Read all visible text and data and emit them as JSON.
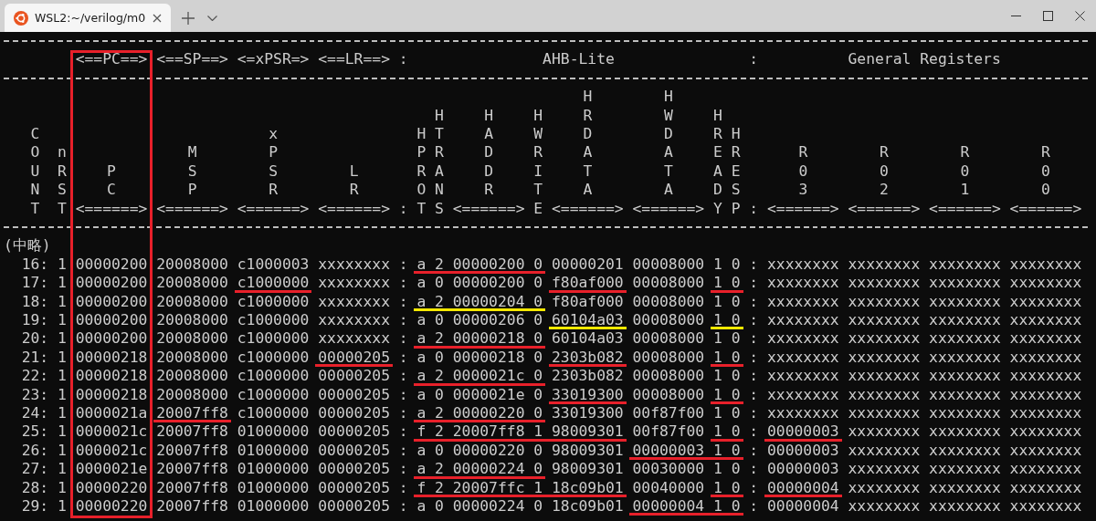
{
  "window": {
    "tab_title": "WSL2:~/verilog/m0"
  },
  "terminal": {
    "title_row": [
      "<==PC==>",
      "<==SP==>",
      "<=xPSR=>",
      "<==LR==>",
      ":",
      "AHB-Lite",
      ":",
      "General Registers"
    ],
    "columns": [
      {
        "label": "COUNT",
        "boxed": false
      },
      {
        "label": "nRST",
        "boxed": false
      },
      {
        "label": "PC",
        "arrow": "<======>",
        "boxed": true
      },
      {
        "label": "MSP",
        "arrow": "<======>",
        "boxed": false
      },
      {
        "label": "xPSR",
        "arrow": "<======>",
        "boxed": false
      },
      {
        "label": "LR",
        "arrow": "<======>",
        "boxed": false
      },
      {
        "label": ":",
        "boxed": false
      },
      {
        "label": "HPROT",
        "boxed": false
      },
      {
        "label": "HTRANS",
        "boxed": false
      },
      {
        "label": "HADDR",
        "arrow": "<======>",
        "boxed": false
      },
      {
        "label": "HWRITE",
        "boxed": false
      },
      {
        "label": "HRDATA",
        "arrow": "<======>",
        "boxed": false
      },
      {
        "label": "HWDATA",
        "arrow": "<======>",
        "boxed": false
      },
      {
        "label": "HREADY",
        "boxed": false
      },
      {
        "label": "HRESP",
        "boxed": false
      },
      {
        "label": ":",
        "boxed": false
      },
      {
        "label": "R03",
        "arrow": "<======>",
        "boxed": false
      },
      {
        "label": "R02",
        "arrow": "<======>",
        "boxed": false
      },
      {
        "label": "R01",
        "arrow": "<======>",
        "boxed": false
      },
      {
        "label": "R00",
        "arrow": "<======>",
        "boxed": false
      }
    ],
    "omitted_marker": "(中略)",
    "rows": [
      {
        "cells": [
          "16:",
          "1",
          "00000200",
          "20008000",
          "c1000003",
          "xxxxxxxx",
          ":",
          {
            "text": "a",
            "color": "#e8202a"
          },
          {
            "text": "2",
            "color": "#e8202a"
          },
          {
            "text": "00000200",
            "color": "#e8202a"
          },
          {
            "text": "0",
            "color": "#e8202a"
          },
          "00000201",
          "00008000",
          "1",
          "0",
          ":",
          "xxxxxxxx",
          "xxxxxxxx",
          "xxxxxxxx",
          "xxxxxxxx"
        ]
      },
      {
        "cells": [
          "17:",
          "1",
          "00000200",
          "20008000",
          {
            "text": "c1000000",
            "color": "#e8202a"
          },
          "xxxxxxxx",
          ":",
          "a",
          "0",
          "00000200",
          "0",
          {
            "text": "f80af000",
            "color": "#e8202a"
          },
          "00008000",
          {
            "text": "1",
            "color": "#e8202a"
          },
          {
            "text": "0",
            "color": "#e8202a"
          },
          ":",
          "xxxxxxxx",
          "xxxxxxxx",
          "xxxxxxxx",
          "xxxxxxxx"
        ]
      },
      {
        "cells": [
          "18:",
          "1",
          "00000200",
          "20008000",
          "c1000000",
          "xxxxxxxx",
          ":",
          {
            "text": "a",
            "color": "#f5e800"
          },
          {
            "text": "2",
            "color": "#f5e800"
          },
          {
            "text": "00000204",
            "color": "#f5e800"
          },
          {
            "text": "0",
            "color": "#f5e800"
          },
          "f80af000",
          "00008000",
          "1",
          "0",
          ":",
          "xxxxxxxx",
          "xxxxxxxx",
          "xxxxxxxx",
          "xxxxxxxx"
        ]
      },
      {
        "cells": [
          "19:",
          "1",
          "00000200",
          "20008000",
          "c1000000",
          "xxxxxxxx",
          ":",
          "a",
          "0",
          "00000206",
          "0",
          {
            "text": "60104a03",
            "color": "#f5e800"
          },
          "00008000",
          {
            "text": "1",
            "color": "#f5e800"
          },
          {
            "text": "0",
            "color": "#f5e800"
          },
          ":",
          "xxxxxxxx",
          "xxxxxxxx",
          "xxxxxxxx",
          "xxxxxxxx"
        ]
      },
      {
        "cells": [
          "20:",
          "1",
          "00000200",
          "20008000",
          "c1000000",
          "xxxxxxxx",
          ":",
          {
            "text": "a",
            "color": "#e8202a"
          },
          {
            "text": "2",
            "color": "#e8202a"
          },
          {
            "text": "00000218",
            "color": "#e8202a"
          },
          {
            "text": "0",
            "color": "#e8202a"
          },
          "60104a03",
          "00008000",
          "1",
          "0",
          ":",
          "xxxxxxxx",
          "xxxxxxxx",
          "xxxxxxxx",
          "xxxxxxxx"
        ]
      },
      {
        "cells": [
          "21:",
          "1",
          "00000218",
          "20008000",
          "c1000000",
          {
            "text": "00000205",
            "color": "#e8202a"
          },
          ":",
          "a",
          "0",
          "00000218",
          "0",
          {
            "text": "2303b082",
            "color": "#e8202a"
          },
          "00008000",
          {
            "text": "1",
            "color": "#e8202a"
          },
          {
            "text": "0",
            "color": "#e8202a"
          },
          ":",
          "xxxxxxxx",
          "xxxxxxxx",
          "xxxxxxxx",
          "xxxxxxxx"
        ]
      },
      {
        "cells": [
          "22:",
          "1",
          "00000218",
          "20008000",
          "c1000000",
          "00000205",
          ":",
          {
            "text": "a",
            "color": "#e8202a"
          },
          {
            "text": "2",
            "color": "#e8202a"
          },
          {
            "text": "0000021c",
            "color": "#e8202a"
          },
          {
            "text": "0",
            "color": "#e8202a"
          },
          "2303b082",
          "00008000",
          "1",
          "0",
          ":",
          "xxxxxxxx",
          "xxxxxxxx",
          "xxxxxxxx",
          "xxxxxxxx"
        ]
      },
      {
        "cells": [
          "23:",
          "1",
          "00000218",
          "20008000",
          "c1000000",
          "00000205",
          ":",
          "a",
          "0",
          "0000021e",
          "0",
          {
            "text": "33019300",
            "color": "#e8202a"
          },
          "00008000",
          {
            "text": "1",
            "color": "#e8202a"
          },
          {
            "text": "0",
            "color": "#e8202a"
          },
          ":",
          "xxxxxxxx",
          "xxxxxxxx",
          "xxxxxxxx",
          "xxxxxxxx"
        ]
      },
      {
        "cells": [
          "24:",
          "1",
          "0000021a",
          {
            "text": "20007ff8",
            "color": "#e8202a"
          },
          "c1000000",
          "00000205",
          ":",
          {
            "text": "a",
            "color": "#e8202a"
          },
          {
            "text": "2",
            "color": "#e8202a"
          },
          {
            "text": "00000220",
            "color": "#e8202a"
          },
          {
            "text": "0",
            "color": "#e8202a"
          },
          "33019300",
          "00f87f00",
          "1",
          "0",
          ":",
          "xxxxxxxx",
          "xxxxxxxx",
          "xxxxxxxx",
          "xxxxxxxx"
        ]
      },
      {
        "cells": [
          "25:",
          "1",
          "0000021c",
          "20007ff8",
          "01000000",
          "00000205",
          ":",
          {
            "text": "f",
            "color": "#e8202a"
          },
          {
            "text": "2",
            "color": "#e8202a"
          },
          {
            "text": "20007ff8",
            "color": "#e8202a"
          },
          {
            "text": "1",
            "color": "#e8202a"
          },
          {
            "text": "98009301",
            "color": "#e8202a"
          },
          "00f87f00",
          {
            "text": "1",
            "color": "#e8202a"
          },
          {
            "text": "0",
            "color": "#e8202a"
          },
          ":",
          {
            "text": "00000003",
            "color": "#e8202a"
          },
          "xxxxxxxx",
          "xxxxxxxx",
          "xxxxxxxx"
        ]
      },
      {
        "cells": [
          "26:",
          "1",
          "0000021c",
          "20007ff8",
          "01000000",
          "00000205",
          ":",
          "a",
          "0",
          "00000220",
          "0",
          "98009301",
          {
            "text": "00000003",
            "color": "#e8202a"
          },
          {
            "text": "1",
            "color": "#e8202a"
          },
          {
            "text": "0",
            "color": "#e8202a"
          },
          ":",
          "00000003",
          "xxxxxxxx",
          "xxxxxxxx",
          "xxxxxxxx"
        ]
      },
      {
        "cells": [
          "27:",
          "1",
          "0000021e",
          "20007ff8",
          "01000000",
          "00000205",
          ":",
          {
            "text": "a",
            "color": "#e8202a"
          },
          {
            "text": "2",
            "color": "#e8202a"
          },
          {
            "text": "00000224",
            "color": "#e8202a"
          },
          {
            "text": "0",
            "color": "#e8202a"
          },
          "98009301",
          "00030000",
          "1",
          "0",
          ":",
          "00000003",
          "xxxxxxxx",
          "xxxxxxxx",
          "xxxxxxxx"
        ]
      },
      {
        "cells": [
          "28:",
          "1",
          "00000220",
          "20007ff8",
          "01000000",
          "00000205",
          ":",
          {
            "text": "f",
            "color": "#e8202a"
          },
          {
            "text": "2",
            "color": "#e8202a"
          },
          {
            "text": "20007ffc",
            "color": "#e8202a"
          },
          {
            "text": "1",
            "color": "#e8202a"
          },
          {
            "text": "18c09b01",
            "color": "#e8202a"
          },
          "00040000",
          {
            "text": "1",
            "color": "#e8202a"
          },
          {
            "text": "0",
            "color": "#e8202a"
          },
          ":",
          {
            "text": "00000004",
            "color": "#e8202a"
          },
          "xxxxxxxx",
          "xxxxxxxx",
          "xxxxxxxx"
        ]
      },
      {
        "cells": [
          "29:",
          "1",
          "00000220",
          "20007ff8",
          "01000000",
          "00000205",
          ":",
          "a",
          "0",
          "00000224",
          "0",
          "18c09b01",
          {
            "text": "00000004",
            "color": "#e8202a"
          },
          {
            "text": "1",
            "color": "#e8202a"
          },
          {
            "text": "0",
            "color": "#e8202a"
          },
          ":",
          "00000004",
          "xxxxxxxx",
          "xxxxxxxx",
          "xxxxxxxx"
        ]
      }
    ]
  }
}
